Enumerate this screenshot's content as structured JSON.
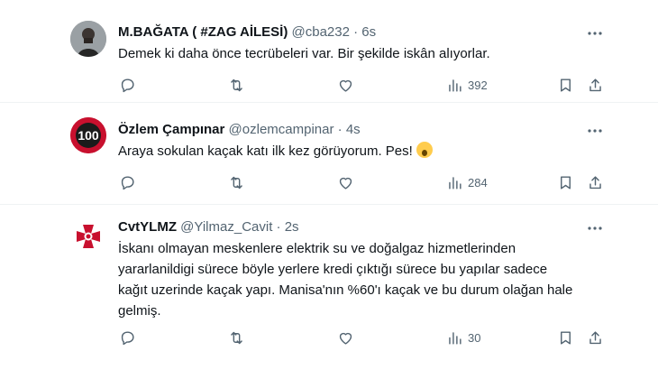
{
  "tweets": [
    {
      "name": "M.BAĞATA ( #ZAG AİLESİ)",
      "handle": "@cba232",
      "sep": "·",
      "time": "6s",
      "text": "Demek ki daha önce tecrübeleri var. Bir şekilde iskân alıyorlar.",
      "views": "392"
    },
    {
      "name": "Özlem Çampınar",
      "handle": "@ozlemcampinar",
      "sep": "·",
      "time": "4s",
      "text": "Araya sokulan kaçak katı ilk kez görüyorum. Pes!",
      "views": "284",
      "avatar_label": "100"
    },
    {
      "name": "CvtYLMZ",
      "handle": "@Yilmaz_Cavit",
      "sep": "·",
      "time": "2s",
      "text_lines": [
        "İskanı olmayan meskenlere elektrik su ve doğalgaz hizmetlerinden",
        "yararlanildigi sürece böyle yerlere kredi çıktığı sürece bu yapılar sadece",
        "kağıt uzerinde kaçak yapı. Manisa'nın %60'ı kaçak ve bu durum olağan hale",
        "gelmiş."
      ],
      "views": "30"
    }
  ],
  "icons": {
    "reply": "reply-icon",
    "retweet": "retweet-icon",
    "like": "heart-icon",
    "views": "views-icon",
    "bookmark": "bookmark-icon",
    "share": "share-icon",
    "more": "more-icon"
  },
  "colors": {
    "text": "#0f1419",
    "secondary": "#536471",
    "divider": "#eff3f4",
    "avatar2": "#c8102e"
  }
}
